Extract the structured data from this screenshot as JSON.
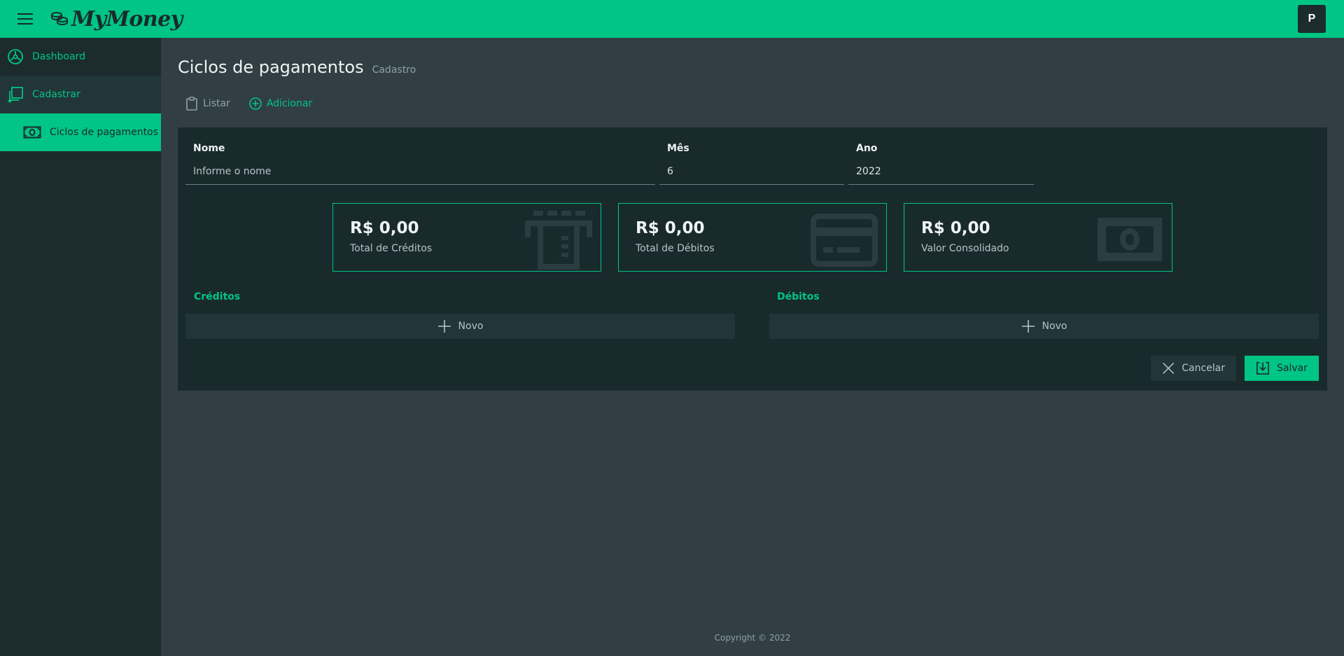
{
  "app": {
    "logo_text": "MyMoney",
    "avatar_initial": "P"
  },
  "sidebar": {
    "items": [
      {
        "label": "Dashboard",
        "icon": "dashboard-icon"
      },
      {
        "label": "Cadastrar",
        "icon": "add-copy-icon"
      },
      {
        "label": "Ciclos de pagamentos",
        "icon": "money-bill-icon"
      }
    ]
  },
  "page": {
    "title": "Ciclos de pagamentos",
    "subtitle": "Cadastro"
  },
  "tabs": [
    {
      "label": "Listar",
      "icon": "clipboard-icon",
      "active": false
    },
    {
      "label": "Adicionar",
      "icon": "plus-circle-icon",
      "active": true
    }
  ],
  "form": {
    "name": {
      "label": "Nome",
      "value": "",
      "placeholder": "Informe o nome"
    },
    "month": {
      "label": "Mês",
      "value": "6"
    },
    "year": {
      "label": "Ano",
      "value": "2022"
    }
  },
  "summary": [
    {
      "value": "R$ 0,00",
      "label": "Total de Créditos",
      "icon": "atm-icon"
    },
    {
      "value": "R$ 0,00",
      "label": "Total de Débitos",
      "icon": "credit-card-icon"
    },
    {
      "value": "R$ 0,00",
      "label": "Valor Consolidado",
      "icon": "money-bill-icon"
    }
  ],
  "credits": {
    "title": "Créditos",
    "new_label": "Novo"
  },
  "debits": {
    "title": "Débitos",
    "new_label": "Novo"
  },
  "actions": {
    "cancel_label": "Cancelar",
    "save_label": "Salvar"
  },
  "footer": {
    "text": "Copyright © 2022"
  },
  "colors": {
    "accent": "#00c584",
    "panel": "#192a2d",
    "background": "#313f44",
    "sidebar": "#1b2b2e"
  }
}
